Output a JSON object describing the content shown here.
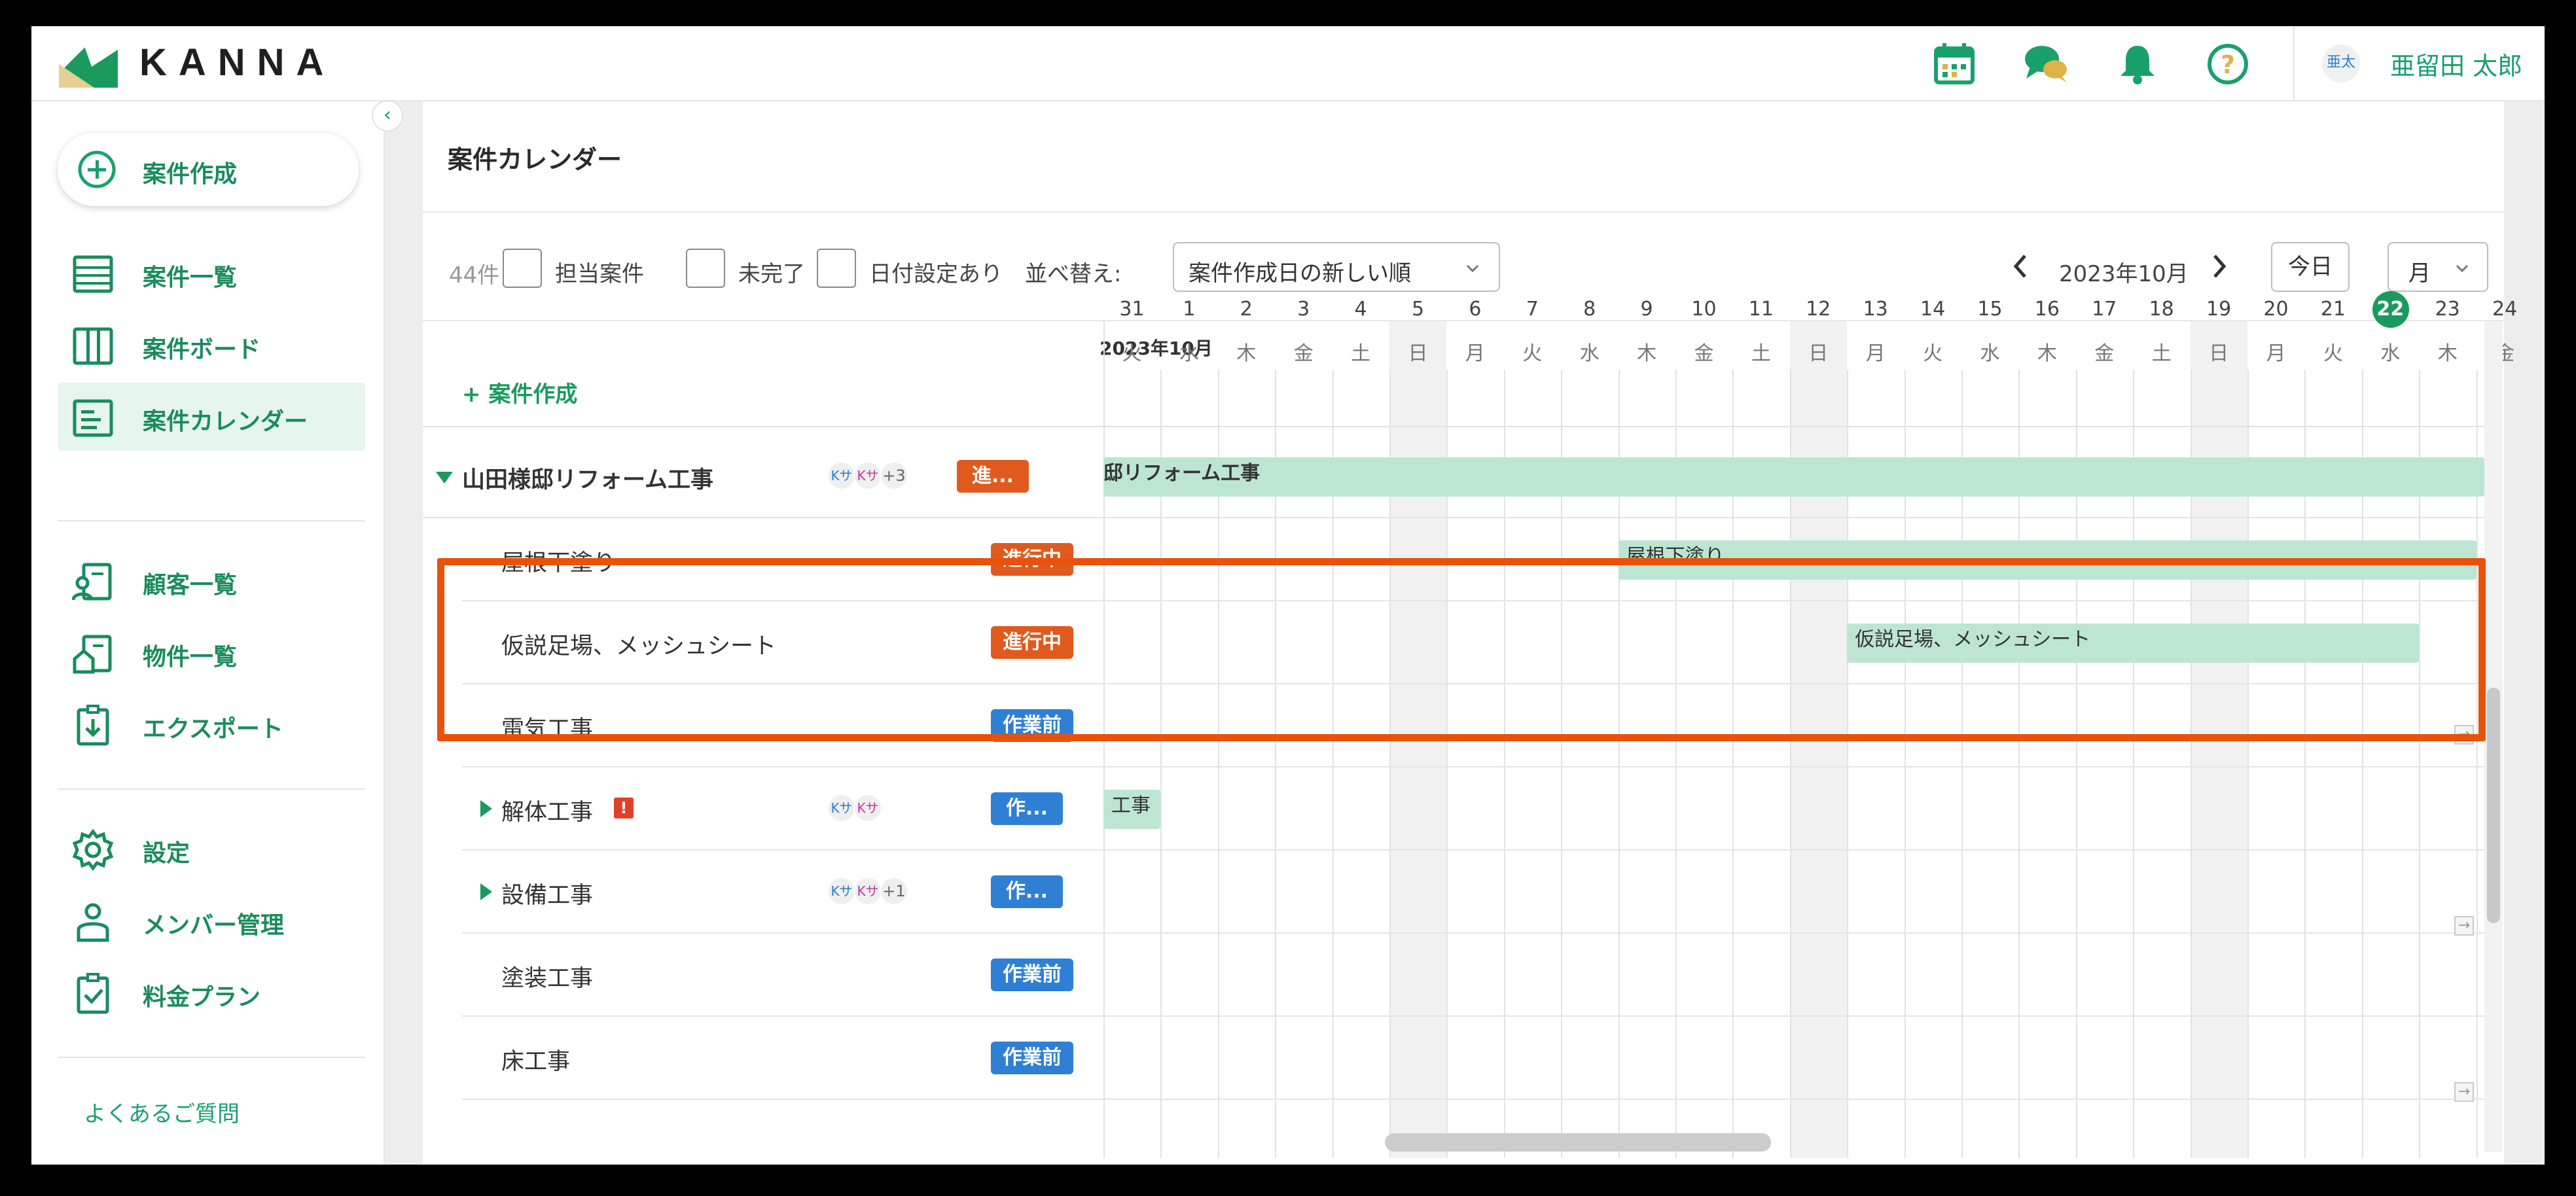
{
  "header": {
    "brand": "KANNA",
    "user_avatar_text": "亜太",
    "user_name": "亜留田 太郎",
    "accent": "#1aa16b"
  },
  "sidebar": {
    "create_label": "案件作成",
    "items": [
      {
        "label": "案件一覧",
        "icon": "list-icon"
      },
      {
        "label": "案件ボード",
        "icon": "board-icon"
      },
      {
        "label": "案件カレンダー",
        "icon": "calendar-icon"
      },
      {
        "label": "顧客一覧",
        "icon": "customer-icon"
      },
      {
        "label": "物件一覧",
        "icon": "property-icon"
      },
      {
        "label": "エクスポート",
        "icon": "export-icon"
      },
      {
        "label": "設定",
        "icon": "gear-icon"
      },
      {
        "label": "メンバー管理",
        "icon": "member-icon"
      },
      {
        "label": "料金プラン",
        "icon": "plan-icon"
      }
    ],
    "faq": "よくあるご質問",
    "collapse_glyph": "‹"
  },
  "page": {
    "title": "案件カレンダー",
    "count": "44件",
    "filters": [
      "担当案件",
      "未完了",
      "日付設定あり"
    ],
    "sort_label": "並べ替え:",
    "sort_value": "案件作成日の新しい順",
    "month_label": "2023年10月",
    "today": "今日",
    "view_mode": "月",
    "create_link": "+ 案件作成",
    "calendar_month": "2023年10月"
  },
  "days": [
    {
      "d": "31",
      "w": "火"
    },
    {
      "d": "1",
      "w": "水"
    },
    {
      "d": "2",
      "w": "木"
    },
    {
      "d": "3",
      "w": "金"
    },
    {
      "d": "4",
      "w": "土"
    },
    {
      "d": "5",
      "w": "日"
    },
    {
      "d": "6",
      "w": "月"
    },
    {
      "d": "7",
      "w": "火"
    },
    {
      "d": "8",
      "w": "水"
    },
    {
      "d": "9",
      "w": "木"
    },
    {
      "d": "10",
      "w": "金"
    },
    {
      "d": "11",
      "w": "土"
    },
    {
      "d": "12",
      "w": "日"
    },
    {
      "d": "13",
      "w": "月"
    },
    {
      "d": "14",
      "w": "火"
    },
    {
      "d": "15",
      "w": "水"
    },
    {
      "d": "16",
      "w": "木"
    },
    {
      "d": "17",
      "w": "金"
    },
    {
      "d": "18",
      "w": "土"
    },
    {
      "d": "19",
      "w": "日"
    },
    {
      "d": "20",
      "w": "月"
    },
    {
      "d": "21",
      "w": "火"
    },
    {
      "d": "22",
      "w": "水"
    },
    {
      "d": "23",
      "w": "木"
    },
    {
      "d": "24",
      "w": "金"
    }
  ],
  "today_index": 22,
  "rows": [
    {
      "name": "山田様邸リフォーム工事",
      "status": "進...",
      "status_type": "prog",
      "avatars": [
        "Kサ",
        "Kサ"
      ],
      "more": "+3",
      "bar": "邸リフォーム工事",
      "start": 0,
      "end": 25,
      "parent": true,
      "expanded": true
    },
    {
      "name": "屋根下塗り",
      "status": "進行中",
      "status_type": "prog",
      "bar": "屋根下塗り",
      "start": 9,
      "end": 24
    },
    {
      "name": "仮説足場、メッシュシート",
      "status": "進行中",
      "status_type": "prog",
      "bar": "仮説足場、メッシュシート",
      "start": 13,
      "end": 23
    },
    {
      "name": "電気工事",
      "status": "作業前",
      "status_type": "pre"
    },
    {
      "name": "解体工事",
      "status": "作...",
      "status_type": "pre",
      "avatars": [
        "Kサ",
        "Kサ"
      ],
      "bar": "工事",
      "start": 0,
      "end": 1,
      "warn": "!",
      "parent": true
    },
    {
      "name": "設備工事",
      "status": "作...",
      "status_type": "pre",
      "avatars": [
        "Kサ",
        "Kサ"
      ],
      "more": "+1",
      "parent": true
    },
    {
      "name": "塗装工事",
      "status": "作業前",
      "status_type": "pre"
    },
    {
      "name": "床工事",
      "status": "作業前",
      "status_type": "pre"
    }
  ],
  "highlight_color": "#e8520c"
}
